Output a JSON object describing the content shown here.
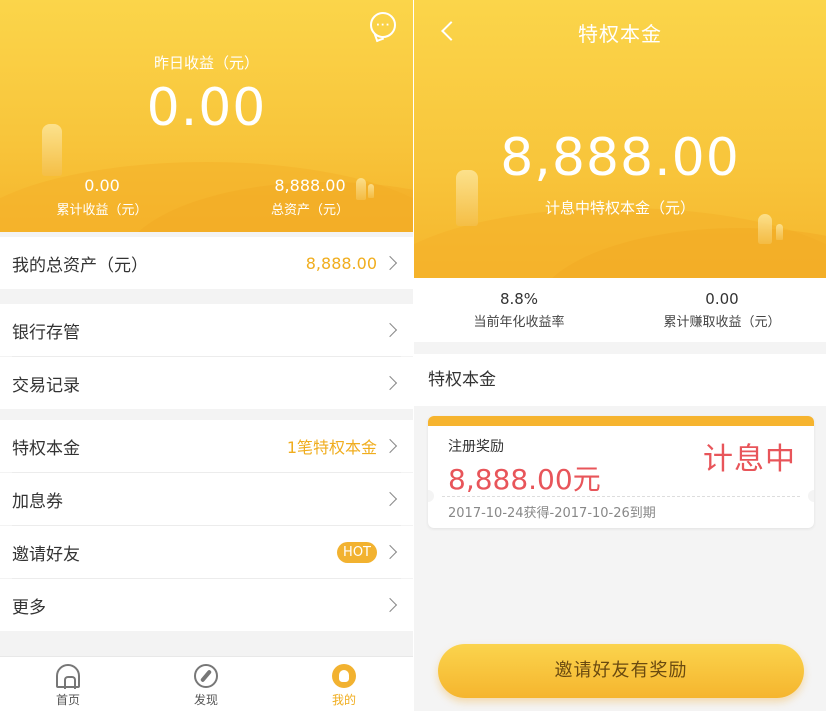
{
  "colors": {
    "accent": "#f8c53b",
    "accent_text": "#f0ad1e",
    "red": "#e8555a"
  },
  "left": {
    "header": {
      "yesterday_label": "昨日收益（元）",
      "yesterday_value": "0.00",
      "cumulative_value": "0.00",
      "cumulative_label": "累计收益（元）",
      "total_value": "8,888.00",
      "total_label": "总资产（元）",
      "message_icon": "chat-bubble-icon"
    },
    "rows": {
      "total_assets": {
        "label": "我的总资产（元）",
        "value": "8,888.00"
      },
      "bank": {
        "label": "银行存管"
      },
      "records": {
        "label": "交易记录"
      },
      "privilege": {
        "label": "特权本金",
        "value": "1笔特权本金"
      },
      "coupon": {
        "label": "加息券"
      },
      "invite": {
        "label": "邀请好友",
        "badge": "HOT"
      },
      "more": {
        "label": "更多"
      }
    },
    "tabbar": [
      {
        "label": "首页",
        "icon": "home-icon"
      },
      {
        "label": "发现",
        "icon": "compass-icon"
      },
      {
        "label": "我的",
        "icon": "me-icon"
      }
    ]
  },
  "right": {
    "title": "特权本金",
    "principal_value": "8,888.00",
    "principal_label": "计息中特权本金（元）",
    "stats": {
      "rate_value": "8.8%",
      "rate_label": "当前年化收益率",
      "earned_value": "0.00",
      "earned_label": "累计赚取收益（元）"
    },
    "section_title": "特权本金",
    "card": {
      "type": "注册奖励",
      "amount": "8,888.00元",
      "status": "计息中",
      "dates": "2017-10-24获得-2017-10-26到期"
    },
    "cta": "邀请好友有奖励"
  }
}
